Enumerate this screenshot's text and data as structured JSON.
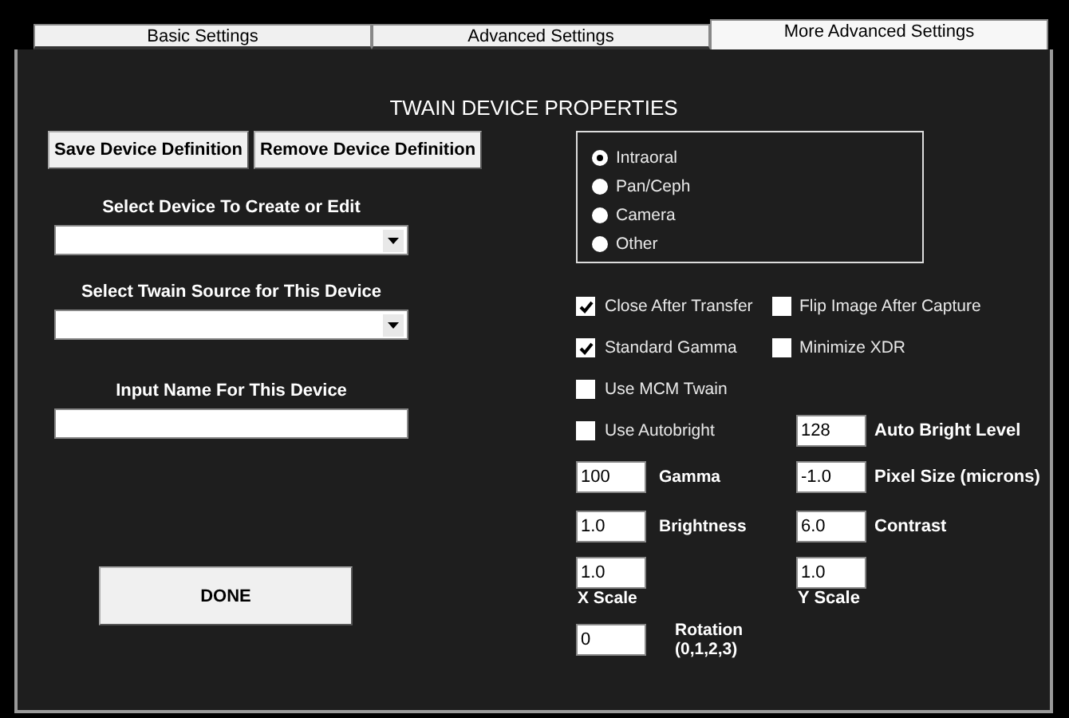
{
  "tabs": [
    {
      "label": "Basic Settings",
      "selected": false
    },
    {
      "label": "Advanced Settings",
      "selected": false
    },
    {
      "label": "More Advanced Settings",
      "selected": true
    }
  ],
  "title": "TWAIN DEVICE PROPERTIES",
  "action_buttons": [
    "Save Device Definition",
    "Remove Device Definition"
  ],
  "left_fields": [
    {
      "label": "Select Device To Create or Edit",
      "kind": "dropdown"
    },
    {
      "label": "Select Twain Source for This Device",
      "kind": "dropdown"
    },
    {
      "label": "Input Name For This Device",
      "kind": "text"
    }
  ],
  "done_button": "DONE",
  "device_types": [
    {
      "label": "Intraoral",
      "selected": true
    },
    {
      "label": "Pan/Ceph",
      "selected": false
    },
    {
      "label": "Camera",
      "selected": false
    },
    {
      "label": "Other",
      "selected": false
    }
  ],
  "settings_rows": [
    [
      {
        "kind": "checkbox",
        "label": "Close After Transfer",
        "checked": true
      },
      {
        "kind": "checkbox",
        "label": "Flip Image After Capture",
        "checked": false
      }
    ],
    [
      {
        "kind": "checkbox",
        "label": "Standard Gamma",
        "checked": true
      },
      {
        "kind": "checkbox",
        "label": "Minimize XDR",
        "checked": false
      }
    ],
    [
      {
        "kind": "checkbox",
        "label": "Use MCM Twain",
        "checked": false
      }
    ],
    [
      {
        "kind": "checkbox",
        "label": "Use Autobright",
        "checked": false
      },
      {
        "kind": "field",
        "value": "128",
        "label": "Auto Bright Level"
      }
    ],
    [
      {
        "kind": "field",
        "value": "100",
        "label": "Gamma"
      },
      {
        "kind": "field",
        "value": "-1.0",
        "label": "Pixel Size (microns)"
      }
    ],
    [
      {
        "kind": "field",
        "value": "1.0",
        "label": "Brightness"
      },
      {
        "kind": "field",
        "value": "6.0",
        "label": "Contrast"
      }
    ],
    [
      {
        "kind": "field_below",
        "value": "1.0",
        "label": "X Scale"
      },
      {
        "kind": "field_below",
        "value": "1.0",
        "label": "Y Scale"
      }
    ],
    [
      {
        "kind": "field",
        "value": "0",
        "label": "Rotation (0,1,2,3)"
      }
    ]
  ]
}
